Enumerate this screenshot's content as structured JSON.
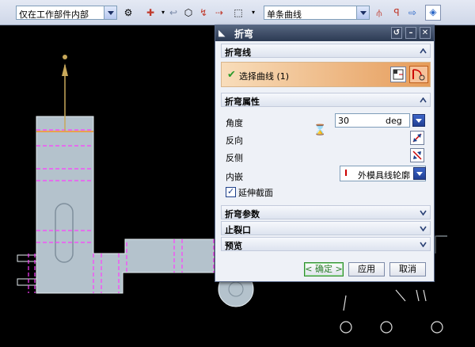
{
  "toolbar": {
    "filter_combo": "仅在工作部件内部",
    "curve_rule_combo": "单条曲线"
  },
  "dialog": {
    "title": "折弯",
    "title_buttons": {
      "reset": "↺",
      "minimize": "–",
      "close": "✕"
    },
    "sections": {
      "bend_line": {
        "title": "折弯线",
        "select_label": "选择曲线 (1)"
      },
      "bend_props": {
        "title": "折弯属性",
        "angle_label": "角度",
        "angle_value": "30",
        "angle_unit": "deg",
        "reverse_label": "反向",
        "flip_side_label": "反侧",
        "inset_label": "内嵌",
        "inset_value": "外模具线轮廓",
        "extend_label": "延伸截面",
        "extend_checked": true
      },
      "bend_params": {
        "title": "折弯参数"
      },
      "relief": {
        "title": "止裂口"
      },
      "preview": {
        "title": "预览"
      }
    },
    "buttons": {
      "ok": "< 确定 >",
      "apply": "应用",
      "cancel": "取消"
    }
  },
  "colors": {
    "part_fill": "#b4c2cc",
    "bend_line": "#ff3cff",
    "selected_curve": "#e8a050",
    "selection_row": "#e69c5a"
  }
}
